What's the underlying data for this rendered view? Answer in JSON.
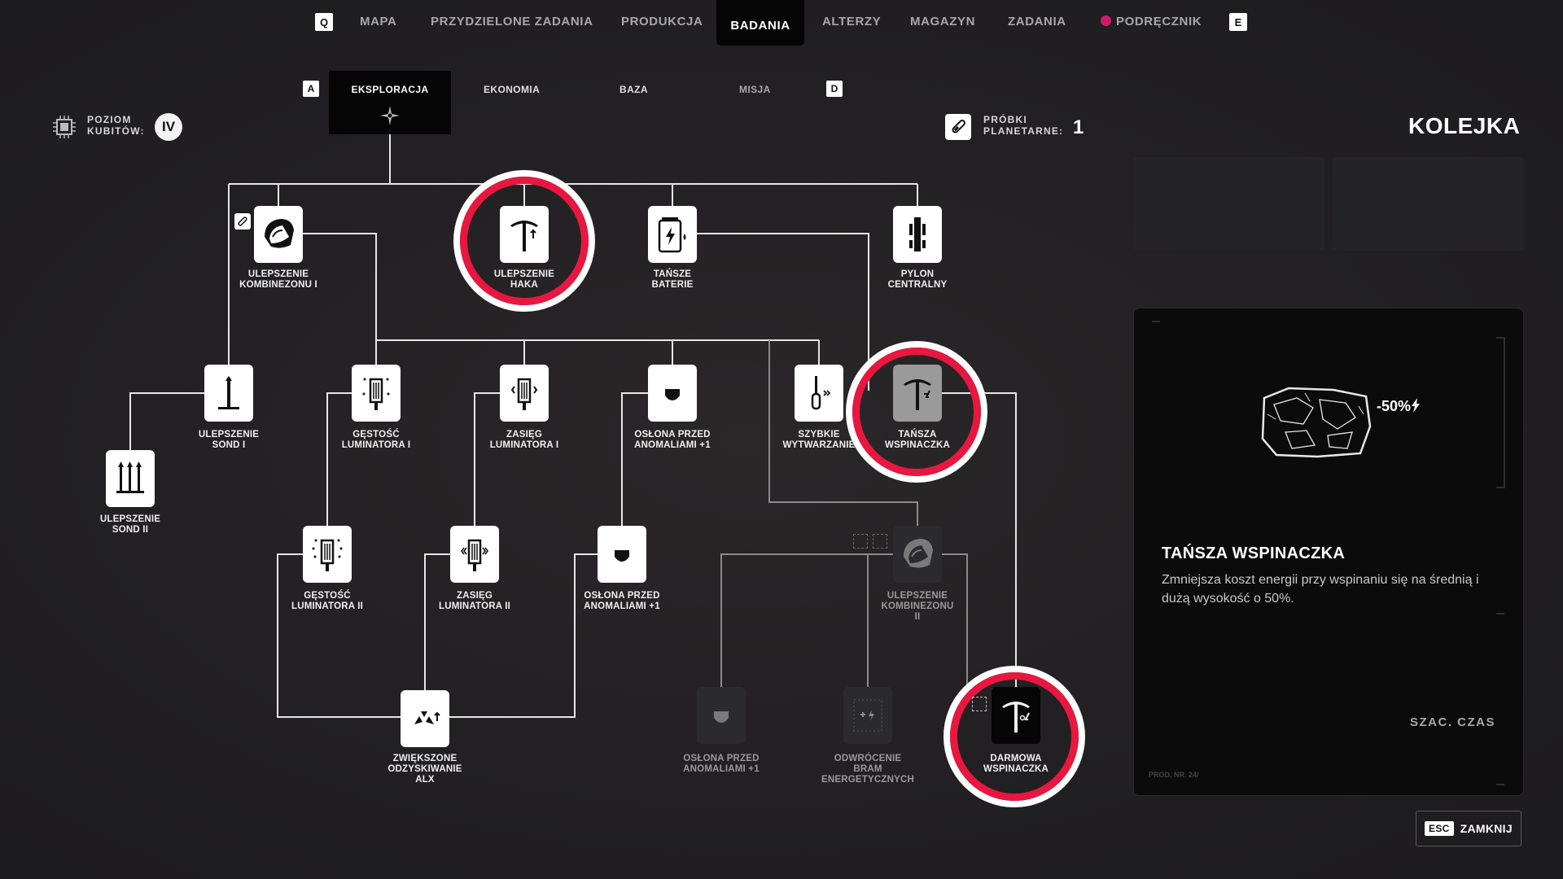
{
  "top_nav": {
    "left_key": "Q",
    "right_key": "E",
    "items": [
      "MAPA",
      "PRZYDZIELONE ZADANIA",
      "PRODUKCJA",
      "BADANIA",
      "ALTERZY",
      "MAGAZYN",
      "ZADANIA",
      "PODRĘCZNIK"
    ],
    "active": "BADANIA"
  },
  "sub_nav": {
    "left_key": "A",
    "right_key": "D",
    "items": [
      "EKSPLORACJA",
      "EKONOMIA",
      "BAZA",
      "MISJA"
    ],
    "active": "EKSPLORACJA"
  },
  "stats": {
    "kubits_label_1": "POZIOM",
    "kubits_label_2": "KUBITÓW:",
    "kubits_value": "IV",
    "samples_label_1": "PRÓBKI",
    "samples_label_2": "PLANETARNE:",
    "samples_value": "1"
  },
  "tree": {
    "nodes": [
      {
        "id": "kombinezon1",
        "line1": "ULEPSZENIE",
        "line2": "KOMBINEZONU I",
        "line3": "",
        "icon": "helmet-icon",
        "state": "unlocked"
      },
      {
        "id": "haka",
        "line1": "ULEPSZENIE",
        "line2": "HAKA",
        "line3": "",
        "icon": "pickaxe-icon",
        "state": "queued"
      },
      {
        "id": "baterie",
        "line1": "TAŃSZE",
        "line2": "BATERIE",
        "line3": "",
        "icon": "battery-icon",
        "state": "unlocked"
      },
      {
        "id": "pylon",
        "line1": "PYLON",
        "line2": "CENTRALNY",
        "line3": "",
        "icon": "pylon-icon",
        "state": "unlocked"
      },
      {
        "id": "sond1",
        "line1": "ULEPSZENIE",
        "line2": "SOND I",
        "line3": "",
        "icon": "probe-icon",
        "state": "unlocked"
      },
      {
        "id": "sond2",
        "line1": "ULEPSZENIE",
        "line2": "SOND II",
        "line3": "",
        "icon": "probes-icon",
        "state": "unlocked"
      },
      {
        "id": "gestosc1",
        "line1": "GĘSTOŚĆ",
        "line2": "LUMINATORA I",
        "line3": "",
        "icon": "luminator-icon",
        "state": "unlocked"
      },
      {
        "id": "zasieg1",
        "line1": "ZASIĘG",
        "line2": "LUMINATORA I",
        "line3": "",
        "icon": "luminator-range-icon",
        "state": "unlocked"
      },
      {
        "id": "oslona1",
        "line1": "OSŁONA PRZED",
        "line2": "ANOMALIAMI +1",
        "line3": "",
        "icon": "shield-icon",
        "state": "unlocked"
      },
      {
        "id": "szybkie",
        "line1": "SZYBKIE",
        "line2": "WYTWARZANIE",
        "line3": "",
        "icon": "tool-icon",
        "state": "unlocked"
      },
      {
        "id": "wspinaczka",
        "line1": "TAŃSZA",
        "line2": "WSPINACZKA",
        "line3": "",
        "icon": "pickaxe-minus-icon",
        "state": "selected"
      },
      {
        "id": "gestosc2",
        "line1": "GĘSTOŚĆ",
        "line2": "LUMINATORA II",
        "line3": "",
        "icon": "luminator-icon",
        "state": "unlocked"
      },
      {
        "id": "zasieg2",
        "line1": "ZASIĘG",
        "line2": "LUMINATORA II",
        "line3": "",
        "icon": "luminator-range-icon",
        "state": "unlocked"
      },
      {
        "id": "oslona2",
        "line1": "OSŁONA PRZED",
        "line2": "ANOMALIAMI +1",
        "line3": "",
        "icon": "shield-icon",
        "state": "unlocked"
      },
      {
        "id": "kombinezon2",
        "line1": "ULEPSZENIE",
        "line2": "KOMBINEZONU",
        "line3": "II",
        "icon": "helmet-icon",
        "state": "locked"
      },
      {
        "id": "alx",
        "line1": "ZWIĘKSZONE",
        "line2": "ODZYSKIWANIE",
        "line3": "ALX",
        "icon": "alx-icon",
        "state": "unlocked"
      },
      {
        "id": "oslona3",
        "line1": "OSŁONA PRZED",
        "line2": "ANOMALIAMI +1",
        "line3": "",
        "icon": "shield-icon",
        "state": "locked"
      },
      {
        "id": "odwrocenie",
        "line1": "ODWRÓCENIE",
        "line2": "BRAM",
        "line3": "ENERGETYCZNYCH",
        "icon": "gate-icon",
        "state": "locked"
      },
      {
        "id": "darmowa",
        "line1": "DARMOWA",
        "line2": "WSPINACZKA",
        "line3": "",
        "icon": "pickaxe-zero-icon",
        "state": "queued"
      }
    ]
  },
  "queue": {
    "title": "KOLEJKA"
  },
  "detail": {
    "badge": "-50%",
    "title": "TAŃSZA WSPINACZKA",
    "description": "Zmniejsza koszt energii przy wspinaniu się na średnią i dużą wysokość o 50%.",
    "time_label": "SZAC. CZAS",
    "prod_text": "PROD. NR. 24/"
  },
  "close": {
    "key": "ESC",
    "label": "ZAMKNIJ"
  }
}
